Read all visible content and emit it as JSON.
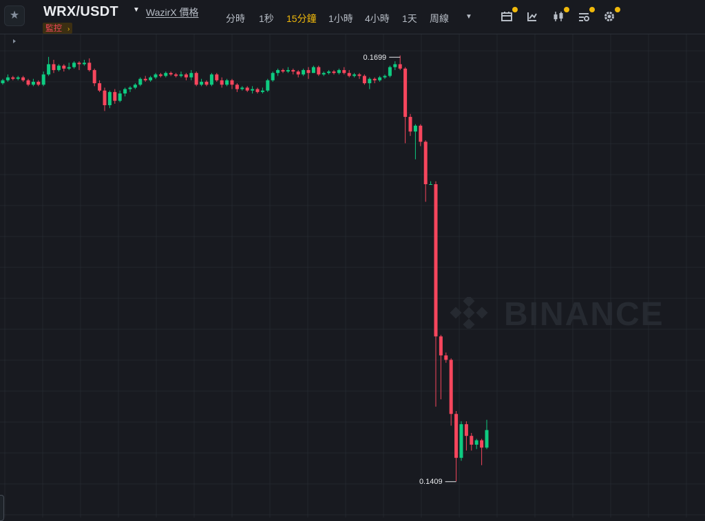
{
  "header": {
    "symbol": "WRX/USDT",
    "price_link": "WazirX 價格",
    "monitor_label": "監控",
    "monitor_arrow": "›",
    "star_icon": "star-icon",
    "intervals": [
      {
        "label": "分時",
        "active": false
      },
      {
        "label": "1秒",
        "active": false
      },
      {
        "label": "15分鐘",
        "active": true
      },
      {
        "label": "1小時",
        "active": false
      },
      {
        "label": "4小時",
        "active": false
      },
      {
        "label": "1天",
        "active": false
      },
      {
        "label": "周線",
        "active": false
      }
    ],
    "tools": [
      "calendar-icon",
      "indicator-icon",
      "candle-style-icon",
      "layout-settings-icon",
      "gear-icon"
    ]
  },
  "colors": {
    "background": "#181a20",
    "grid": "#2b3139",
    "up": "#0ecb81",
    "down": "#f6465d",
    "accent": "#f0b90b",
    "label": "#eaecef"
  },
  "watermark": {
    "text": "BINANCE"
  },
  "chart_data": {
    "type": "candlestick",
    "interval": "15分鐘",
    "ylim": [
      0.1395,
      0.1705
    ],
    "grid": true,
    "high_label": "0.1699",
    "low_label": "0.1409",
    "candles": [
      [
        0.1681,
        0.1683,
        0.1684,
        0.168
      ],
      [
        0.1683,
        0.1685,
        0.1687,
        0.1682
      ],
      [
        0.1685,
        0.1684,
        0.1686,
        0.1683
      ],
      [
        0.1684,
        0.1685,
        0.1686,
        0.1683
      ],
      [
        0.1685,
        0.1683,
        0.1686,
        0.1682
      ],
      [
        0.1683,
        0.168,
        0.1684,
        0.1679
      ],
      [
        0.168,
        0.1682,
        0.1684,
        0.1679
      ],
      [
        0.1682,
        0.168,
        0.1683,
        0.1679
      ],
      [
        0.168,
        0.1687,
        0.1689,
        0.1679
      ],
      [
        0.1687,
        0.1694,
        0.1699,
        0.1686
      ],
      [
        0.1694,
        0.169,
        0.1697,
        0.1688
      ],
      [
        0.169,
        0.1693,
        0.1694,
        0.1689
      ],
      [
        0.1693,
        0.1691,
        0.1694,
        0.1689
      ],
      [
        0.1691,
        0.1692,
        0.1695,
        0.169
      ],
      [
        0.1692,
        0.1695,
        0.1696,
        0.1691
      ],
      [
        0.1695,
        0.1694,
        0.1696,
        0.169
      ],
      [
        0.1694,
        0.1695,
        0.1697,
        0.1693
      ],
      [
        0.1695,
        0.169,
        0.1698,
        0.1689
      ],
      [
        0.169,
        0.1681,
        0.1691,
        0.1679
      ],
      [
        0.1681,
        0.1676,
        0.1683,
        0.1675
      ],
      [
        0.1676,
        0.1666,
        0.1678,
        0.1662
      ],
      [
        0.1666,
        0.1675,
        0.1676,
        0.1664
      ],
      [
        0.1675,
        0.1669,
        0.1677,
        0.1667
      ],
      [
        0.1669,
        0.1674,
        0.1676,
        0.1668
      ],
      [
        0.1674,
        0.1677,
        0.1678,
        0.1672
      ],
      [
        0.1677,
        0.1678,
        0.1679,
        0.1675
      ],
      [
        0.1678,
        0.168,
        0.1681,
        0.1677
      ],
      [
        0.168,
        0.1684,
        0.1685,
        0.1679
      ],
      [
        0.1684,
        0.1683,
        0.1686,
        0.1682
      ],
      [
        0.1683,
        0.1685,
        0.1686,
        0.1682
      ],
      [
        0.1685,
        0.1687,
        0.1688,
        0.1684
      ],
      [
        0.1687,
        0.1686,
        0.1688,
        0.1685
      ],
      [
        0.1686,
        0.1688,
        0.1689,
        0.1685
      ],
      [
        0.1688,
        0.1687,
        0.1689,
        0.1686
      ],
      [
        0.1687,
        0.1686,
        0.1688,
        0.1685
      ],
      [
        0.1686,
        0.1687,
        0.1689,
        0.1685
      ],
      [
        0.1687,
        0.1685,
        0.1688,
        0.1683
      ],
      [
        0.1685,
        0.1688,
        0.169,
        0.1683
      ],
      [
        0.1688,
        0.168,
        0.1689,
        0.1679
      ],
      [
        0.168,
        0.1682,
        0.1684,
        0.1679
      ],
      [
        0.1682,
        0.168,
        0.1683,
        0.1679
      ],
      [
        0.168,
        0.1687,
        0.1688,
        0.1679
      ],
      [
        0.1687,
        0.1683,
        0.1688,
        0.1682
      ],
      [
        0.1683,
        0.168,
        0.1685,
        0.1678
      ],
      [
        0.168,
        0.1683,
        0.1684,
        0.1679
      ],
      [
        0.1683,
        0.168,
        0.1684,
        0.1677
      ],
      [
        0.168,
        0.1677,
        0.1681,
        0.1675
      ],
      [
        0.1677,
        0.1678,
        0.1679,
        0.1676
      ],
      [
        0.1678,
        0.1676,
        0.1679,
        0.1675
      ],
      [
        0.1676,
        0.1677,
        0.1679,
        0.1674
      ],
      [
        0.1677,
        0.1675,
        0.1678,
        0.1674
      ],
      [
        0.1675,
        0.1676,
        0.1678,
        0.1674
      ],
      [
        0.1676,
        0.1683,
        0.1684,
        0.1675
      ],
      [
        0.1683,
        0.1688,
        0.1689,
        0.1682
      ],
      [
        0.1688,
        0.169,
        0.1691,
        0.1686
      ],
      [
        0.169,
        0.1689,
        0.1691,
        0.1688
      ],
      [
        0.1689,
        0.169,
        0.1692,
        0.1688
      ],
      [
        0.169,
        0.1689,
        0.1691,
        0.1687
      ],
      [
        0.1689,
        0.1687,
        0.169,
        0.1685
      ],
      [
        0.1687,
        0.169,
        0.1691,
        0.1686
      ],
      [
        0.169,
        0.1688,
        0.1692,
        0.1684
      ],
      [
        0.1688,
        0.1692,
        0.1693,
        0.1688
      ],
      [
        0.1692,
        0.1687,
        0.1693,
        0.1686
      ],
      [
        0.1687,
        0.1688,
        0.1689,
        0.1686
      ],
      [
        0.1688,
        0.1689,
        0.169,
        0.1687
      ],
      [
        0.1689,
        0.1688,
        0.169,
        0.1687
      ],
      [
        0.1688,
        0.169,
        0.1691,
        0.1687
      ],
      [
        0.169,
        0.1688,
        0.1692,
        0.1687
      ],
      [
        0.1688,
        0.1686,
        0.169,
        0.1685
      ],
      [
        0.1686,
        0.1687,
        0.1688,
        0.1685
      ],
      [
        0.1687,
        0.1686,
        0.1688,
        0.1684
      ],
      [
        0.1686,
        0.1681,
        0.1687,
        0.168
      ],
      [
        0.1681,
        0.1684,
        0.1685,
        0.1677
      ],
      [
        0.1684,
        0.1683,
        0.1685,
        0.1681
      ],
      [
        0.1683,
        0.1685,
        0.1686,
        0.1682
      ],
      [
        0.1685,
        0.1686,
        0.1687,
        0.1684
      ],
      [
        0.1686,
        0.1692,
        0.1693,
        0.1685
      ],
      [
        0.1692,
        0.1694,
        0.1696,
        0.169
      ],
      [
        0.1694,
        0.1691,
        0.17,
        0.169
      ],
      [
        0.1691,
        0.1658,
        0.1692,
        0.164
      ],
      [
        0.1658,
        0.1648,
        0.166,
        0.1645
      ],
      [
        0.1648,
        0.1652,
        0.1653,
        0.1629
      ],
      [
        0.1652,
        0.1641,
        0.1653,
        0.1638
      ],
      [
        0.1641,
        0.1612,
        0.1642,
        0.16
      ],
      [
        0.1612,
        0.1612,
        0.1614,
        0.1612
      ],
      [
        0.1612,
        0.1508,
        0.1614,
        0.146
      ],
      [
        0.1508,
        0.1495,
        0.1509,
        0.1465
      ],
      [
        0.1495,
        0.1492,
        0.1497,
        0.149
      ],
      [
        0.1492,
        0.1455,
        0.1493,
        0.1447
      ],
      [
        0.1455,
        0.1425,
        0.1457,
        0.1409
      ],
      [
        0.1425,
        0.1448,
        0.145,
        0.1423
      ],
      [
        0.1448,
        0.144,
        0.145,
        0.143
      ],
      [
        0.144,
        0.1434,
        0.1442,
        0.143
      ],
      [
        0.1434,
        0.1437,
        0.1438,
        0.1431
      ],
      [
        0.1437,
        0.1432,
        0.1438,
        0.142
      ],
      [
        0.1432,
        0.1444,
        0.1451,
        0.1431
      ]
    ]
  }
}
